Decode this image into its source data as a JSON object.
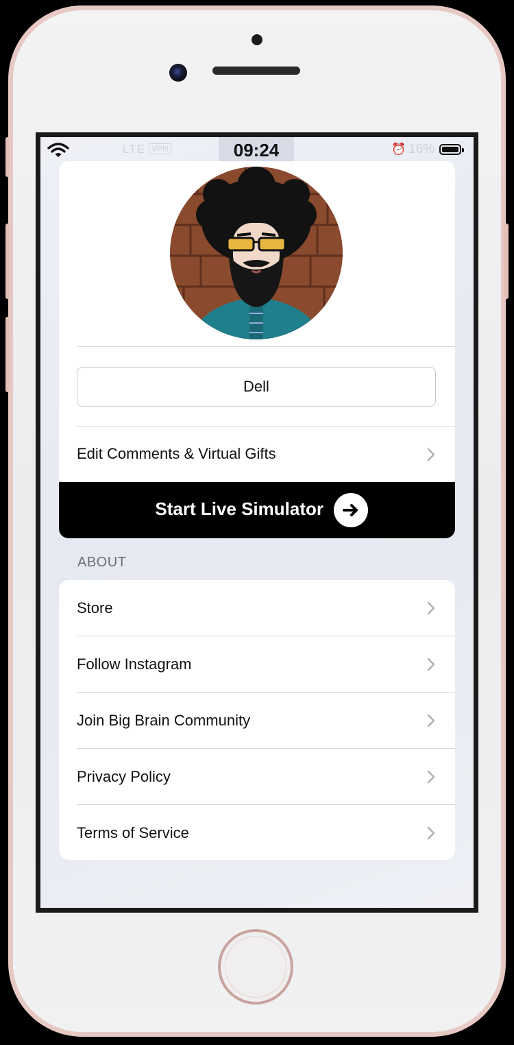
{
  "status_bar": {
    "network": "LTE",
    "vpn": "VPN",
    "time": "09:24",
    "battery": "16%"
  },
  "profile": {
    "name": "Dell"
  },
  "main_menu": {
    "edit_comments_label": "Edit Comments & Virtual Gifts",
    "start_button_label": "Start Live Simulator"
  },
  "about": {
    "header": "ABOUT",
    "items": [
      {
        "label": "Store"
      },
      {
        "label": "Follow Instagram"
      },
      {
        "label": "Join Big Brain Community"
      },
      {
        "label": "Privacy Policy"
      },
      {
        "label": "Terms of Service"
      }
    ]
  },
  "colors": {
    "accent": "#000000",
    "chevron": "#b0b0b5",
    "card": "#ffffff",
    "background": "#eef0f6"
  },
  "icons": [
    "wifi-icon",
    "alarm-icon",
    "battery-icon",
    "chevron-right-icon",
    "arrow-right-icon",
    "avatar"
  ]
}
